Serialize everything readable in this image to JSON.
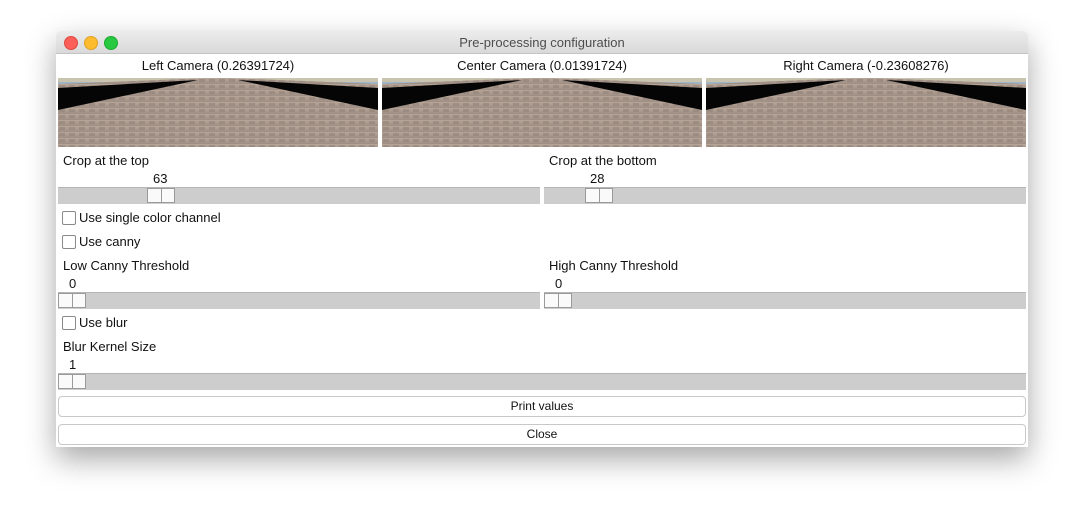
{
  "window": {
    "title": "Pre-processing configuration"
  },
  "cameras": [
    {
      "label": "Left Camera (0.26391724)"
    },
    {
      "label": "Center Camera (0.01391724)"
    },
    {
      "label": "Right Camera (-0.23608276)"
    }
  ],
  "crop_top": {
    "label": "Crop at the top",
    "value": "63",
    "fraction": 0.26
  },
  "crop_bottom": {
    "label": "Crop at the bottom",
    "value": "28",
    "fraction": 0.09
  },
  "single_channel": {
    "label": "Use single color channel",
    "checked": false
  },
  "canny": {
    "label": "Use canny",
    "checked": false
  },
  "low_canny": {
    "label": "Low Canny Threshold",
    "value": "0",
    "fraction": 0
  },
  "high_canny": {
    "label": "High Canny Threshold",
    "value": "0",
    "fraction": 0
  },
  "blur": {
    "label": "Use blur",
    "checked": false
  },
  "blur_kernel": {
    "label": "Blur Kernel Size",
    "value": "1",
    "fraction": 0
  },
  "buttons": {
    "print": "Print values",
    "close": "Close"
  }
}
